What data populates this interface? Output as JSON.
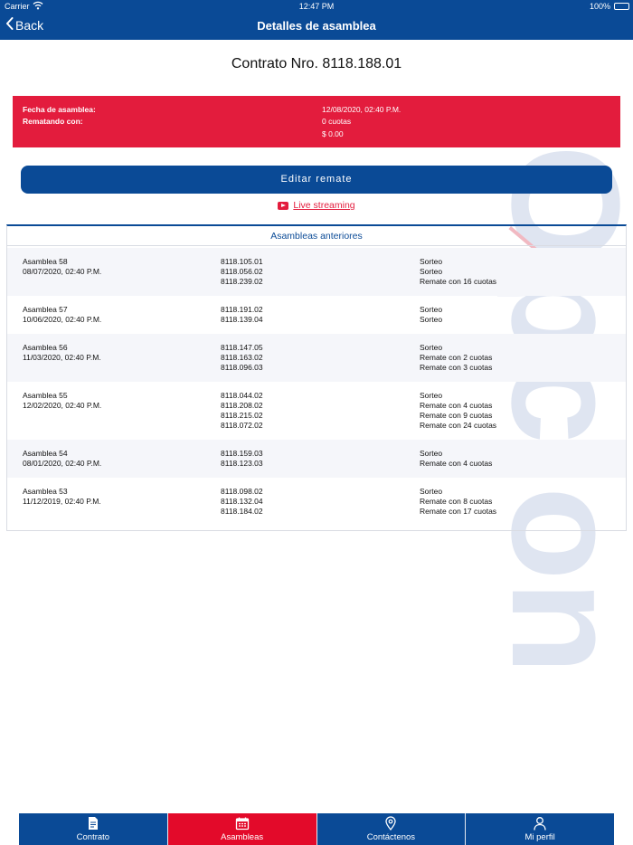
{
  "status": {
    "carrier": "Carrier",
    "time": "12:47 PM",
    "battery": "100%"
  },
  "nav": {
    "back_label": "Back",
    "title": "Detalles de asamblea"
  },
  "contract": {
    "title": "Contrato Nro. 8118.188.01"
  },
  "summary": {
    "fecha_label": "Fecha de asamblea:",
    "fecha_value": "12/08/2020, 02:40 P.M.",
    "rematando_label": "Rematando con:",
    "cuotas_value": "0 cuotas",
    "monto_value": "$ 0.00"
  },
  "actions": {
    "edit_label": "Editar remate",
    "live_label": "Live streaming"
  },
  "watermark": {
    "text": "Opcion"
  },
  "table": {
    "heading": "Asambleas anteriores",
    "rows": [
      {
        "name": "Asamblea 58",
        "date": "08/07/2020, 02:40 P.M.",
        "contracts": [
          "8118.105.01",
          "8118.056.02",
          "8118.239.02"
        ],
        "results": [
          "Sorteo",
          "Sorteo",
          "Remate con 16 cuotas"
        ]
      },
      {
        "name": "Asamblea 57",
        "date": "10/06/2020, 02:40 P.M.",
        "contracts": [
          "8118.191.02",
          "8118.139.04"
        ],
        "results": [
          "Sorteo",
          "Sorteo"
        ]
      },
      {
        "name": "Asamblea 56",
        "date": "11/03/2020, 02:40 P.M.",
        "contracts": [
          "8118.147.05",
          "8118.163.02",
          "8118.096.03"
        ],
        "results": [
          "Sorteo",
          "Remate con 2 cuotas",
          "Remate con 3 cuotas"
        ]
      },
      {
        "name": "Asamblea 55",
        "date": "12/02/2020, 02:40 P.M.",
        "contracts": [
          "8118.044.02",
          "8118.208.02",
          "8118.215.02",
          "8118.072.02"
        ],
        "results": [
          "Sorteo",
          "Remate con 4 cuotas",
          "Remate con 9 cuotas",
          "Remate con 24 cuotas"
        ]
      },
      {
        "name": "Asamblea 54",
        "date": "08/01/2020, 02:40 P.M.",
        "contracts": [
          "8118.159.03",
          "8118.123.03"
        ],
        "results": [
          "Sorteo",
          "Remate con 4 cuotas"
        ]
      },
      {
        "name": "Asamblea 53",
        "date": "11/12/2019, 02:40 P.M.",
        "contracts": [
          "8118.098.02",
          "8118.132.04",
          "8118.184.02"
        ],
        "results": [
          "Sorteo",
          "Remate con 8 cuotas",
          "Remate con 17 cuotas"
        ]
      }
    ]
  },
  "tabs": [
    {
      "label": "Contrato",
      "icon": "document-icon"
    },
    {
      "label": "Asambleas",
      "icon": "calendar-icon"
    },
    {
      "label": "Contáctenos",
      "icon": "location-pin-icon"
    },
    {
      "label": "Mi perfil",
      "icon": "user-icon"
    }
  ],
  "colors": {
    "brand_blue": "#0a4a96",
    "accent_red": "#e31c3d",
    "active_tab": "#e30a2a"
  }
}
